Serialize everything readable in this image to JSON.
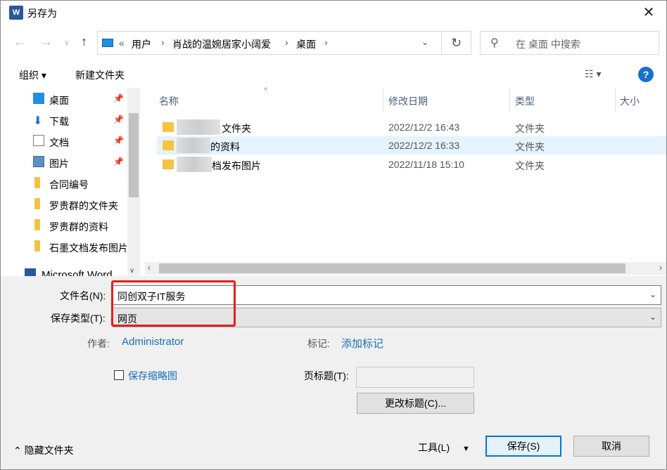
{
  "window": {
    "title": "另存为",
    "app_icon_letter": "W"
  },
  "navbar": {
    "breadcrumb": [
      "«",
      "用户",
      "肖战的温婉居家小阔爱",
      "桌面"
    ],
    "search_placeholder": "在 桌面 中搜索"
  },
  "toolbar": {
    "organize": "组织 ▾",
    "new_folder": "新建文件夹",
    "help": "?"
  },
  "sidebar": {
    "items": [
      {
        "label": "桌面",
        "icon": "desktop-icon",
        "pinned": true
      },
      {
        "label": "下载",
        "icon": "download-icon",
        "pinned": true
      },
      {
        "label": "文档",
        "icon": "document-icon",
        "pinned": true
      },
      {
        "label": "图片",
        "icon": "picture-icon",
        "pinned": true
      },
      {
        "label": "合同编号",
        "icon": "folder-icon",
        "pinned": false
      },
      {
        "label": "罗贵群的文件夹",
        "icon": "folder-icon",
        "pinned": false
      },
      {
        "label": "罗贵群的资料",
        "icon": "folder-icon",
        "pinned": false
      },
      {
        "label": "石墨文档发布图片",
        "icon": "folder-icon",
        "pinned": false
      },
      {
        "label": "Microsoft Word",
        "icon": "word-icon",
        "pinned": false
      }
    ]
  },
  "list": {
    "columns": [
      "名称",
      "修改日期",
      "类型",
      "大小"
    ],
    "rows": [
      {
        "name_suffix": "文件夹",
        "date": "2022/12/2 16:43",
        "type": "文件夹",
        "selected": false
      },
      {
        "name_suffix": "的资料",
        "date": "2022/12/2 16:33",
        "type": "文件夹",
        "selected": true
      },
      {
        "name_suffix": "档发布图片",
        "date": "2022/11/18 15:10",
        "type": "文件夹",
        "selected": false
      }
    ]
  },
  "form": {
    "filename_label": "文件名(N):",
    "filename_value": "同创双子IT服务",
    "filetype_label": "保存类型(T):",
    "filetype_value": "网页",
    "author_label": "作者:",
    "author_value": "Administrator",
    "tags_label": "标记:",
    "tags_value": "添加标记",
    "thumbnail_label": "保存缩略图",
    "page_title_label": "页标题(T):",
    "page_title_value": "",
    "change_title_button": "更改标题(C)..."
  },
  "footer": {
    "hide_folders": "隐藏文件夹",
    "tools": "工具(L)",
    "save": "保存(S)",
    "cancel": "取消"
  },
  "colors": {
    "accent": "#0078d7",
    "highlight_box": "#e02020",
    "link": "#1a6fb8",
    "selected_row": "#e5f3ff"
  }
}
